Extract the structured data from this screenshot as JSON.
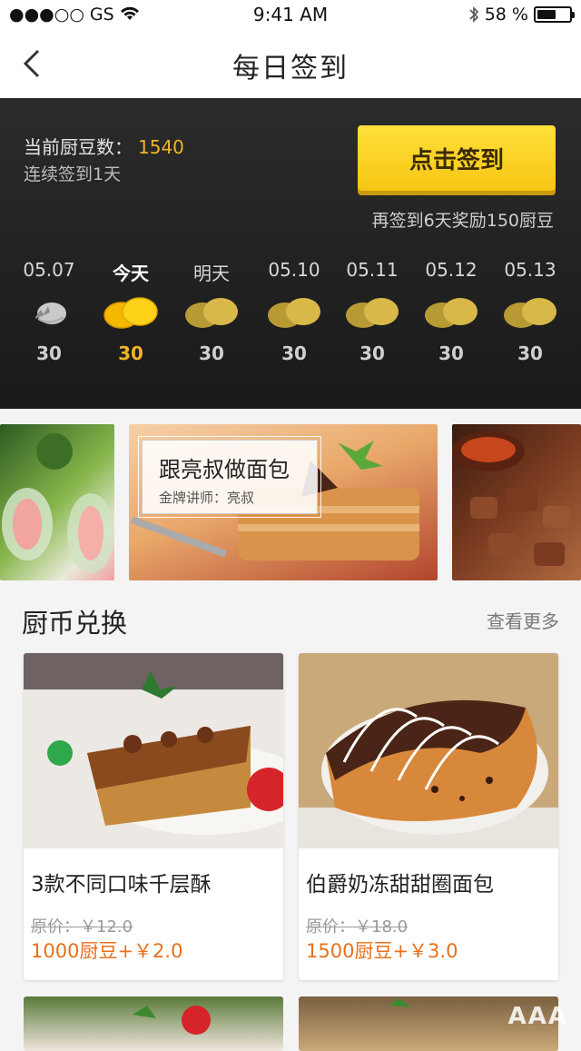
{
  "status_bar": {
    "carrier": "●●●○○ GS",
    "time": "9:41 AM",
    "battery": "58 %",
    "battery_level": 0.58
  },
  "nav": {
    "title": "每日签到"
  },
  "checkin": {
    "beans_label": "当前厨豆数：",
    "beans_value": "1540",
    "streak": "连续签到1天",
    "button": "点击签到",
    "reward_hint": "再签到6天奖励150厨豆",
    "days": [
      {
        "label": "05.07",
        "points": "30",
        "state": "cracked"
      },
      {
        "label": "今天",
        "points": "30",
        "state": "today"
      },
      {
        "label": "明天",
        "points": "30",
        "state": "future"
      },
      {
        "label": "05.10",
        "points": "30",
        "state": "future"
      },
      {
        "label": "05.11",
        "points": "30",
        "state": "future"
      },
      {
        "label": "05.12",
        "points": "30",
        "state": "future"
      },
      {
        "label": "05.13",
        "points": "30",
        "state": "future"
      }
    ]
  },
  "banner": {
    "title": "跟亮叔做面包",
    "subtitle": "金牌讲师：亮叔"
  },
  "exchange": {
    "heading": "厨币兑换",
    "more": "查看更多",
    "products": [
      {
        "name": "3款不同口味千层酥",
        "original": "原价：￥12.0",
        "price": "1000厨豆+￥2.0"
      },
      {
        "name": "伯爵奶冻甜甜圈面包",
        "original": "原价：￥18.0",
        "price": "1500厨豆+￥3.0"
      }
    ]
  },
  "watermark": "AAA",
  "colors": {
    "accent": "#f0b429",
    "button": "#fad21f",
    "price": "#e8701a",
    "dark_bg": "#222222"
  }
}
